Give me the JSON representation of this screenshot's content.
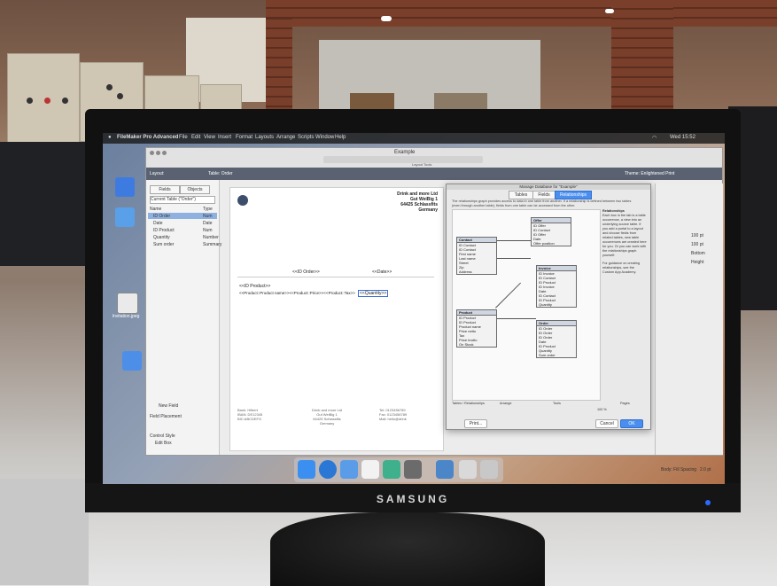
{
  "monitor": {
    "brand": "SAMSUNG"
  },
  "menubar": {
    "app_name": "FileMaker Pro Advanced",
    "items": [
      "File",
      "Edit",
      "View",
      "Insert",
      "Format",
      "Layouts",
      "Arrange",
      "Scripts",
      "Window",
      "Help"
    ],
    "clock": "Wed 15:52"
  },
  "fm_window": {
    "title": "Example",
    "theme": "Theme: Enlightened Print",
    "layout_tools_label": "Layout Tools",
    "layout_label": "Layout:",
    "layout_name": "Table: Order",
    "tabs": [
      "Fields",
      "Objects"
    ],
    "table_select": "Current Table (\"Order\")",
    "field_list_headers": [
      "Name",
      "Type"
    ],
    "fields": [
      {
        "name": "ID Order",
        "type": "Num"
      },
      {
        "name": "Date",
        "type": "Date"
      },
      {
        "name": "ID Product",
        "type": "Num"
      },
      {
        "name": "Quantity",
        "type": "Number"
      },
      {
        "name": "Sum order",
        "type": "Summary"
      }
    ],
    "new_field": "New Field",
    "field_placement": "Field Placement",
    "control_style": "Control Style",
    "edit_box": "Edit Box",
    "bottom_left": "100"
  },
  "layout_canvas": {
    "company": "Drink and more Ltd",
    "street": "Gut WeiBig 1",
    "city": "64425 Schlassfits",
    "country": "Germany",
    "order_field": "<<ID Order>>",
    "date_field": "<<Date>>",
    "product_field": "<<ID Product>>",
    "line_fields": "<<Product::Product name>><<Product::Price>><<Product::Tax>>",
    "quantity_field": "<<Quantity>>",
    "footer_left": [
      "Bank: Hilbert",
      "IBAN: DE12345",
      "BIC:ABCDEFG"
    ],
    "footer_mid": [
      "Drink and more Ltd",
      "Gut WeiBig 1",
      "64425 Schlassfits",
      "Germany"
    ],
    "footer_right": [
      "Tel: 0123456789",
      "Fax: 0123456789",
      "Mail: hello@drink"
    ]
  },
  "dialog": {
    "title": "Manage Database for \"Example\"",
    "tabs": [
      "Tables",
      "Fields",
      "Relationships"
    ],
    "active_tab": "Relationships",
    "intro": "The relationships graph provides access to data in one table from another. If a relationship is defined between two tables (even through another table), fields from one table can be accessed from the other.",
    "tables": [
      {
        "name": "Offer",
        "fields": [
          "ID Offer",
          "ID Contact",
          "ID Offer",
          "Date",
          "Offer position"
        ]
      },
      {
        "name": "Contact",
        "fields": [
          "ID Contact",
          "ID Contact",
          "First name",
          "Last name",
          "Street",
          "Zip",
          "Address"
        ]
      },
      {
        "name": "Invoice",
        "fields": [
          "ID Invoice",
          "ID Contact",
          "ID Product",
          "ID Invoice",
          "Date",
          "ID Contact",
          "ID Product",
          "Quantity"
        ]
      },
      {
        "name": "Product",
        "fields": [
          "ID Product",
          "ID Product",
          "Product name",
          "Price netto",
          "Tax",
          "Price brutto",
          "On Stock"
        ]
      },
      {
        "name": "Order",
        "fields": [
          "ID Order",
          "ID Order",
          "ID Order",
          "Date",
          "ID Product",
          "Quantity",
          "Sum order"
        ]
      }
    ],
    "help_title": "Relationships",
    "help_text": "Each box in the tab is a table occurrence, a view into an underlying source table. If you add a portal to a layout and choose fields from related tables, new table occurrences are created here for you. Or you can work with the relationships graph yourself.",
    "help_more": "For guidance on creating relationships, see the Custom App Academy.",
    "toolbar_labels": [
      "Tables / Relationships",
      "Arrange",
      "Tools",
      "Pages"
    ],
    "zoom": "100 %",
    "print": "Print...",
    "cancel": "Cancel",
    "ok": "OK"
  },
  "inspector": {
    "rows": [
      "100 pt",
      "100 pt",
      "Bottom",
      "Height"
    ],
    "bottom_label": "Body: Fill Spacing",
    "bottom_value": "2.0 pt"
  },
  "desktop": {
    "file_label": "Invitation.jpeg"
  },
  "colors": {
    "dialog_accent": "#4a8ff0",
    "layout_bar": "#5a6272"
  }
}
